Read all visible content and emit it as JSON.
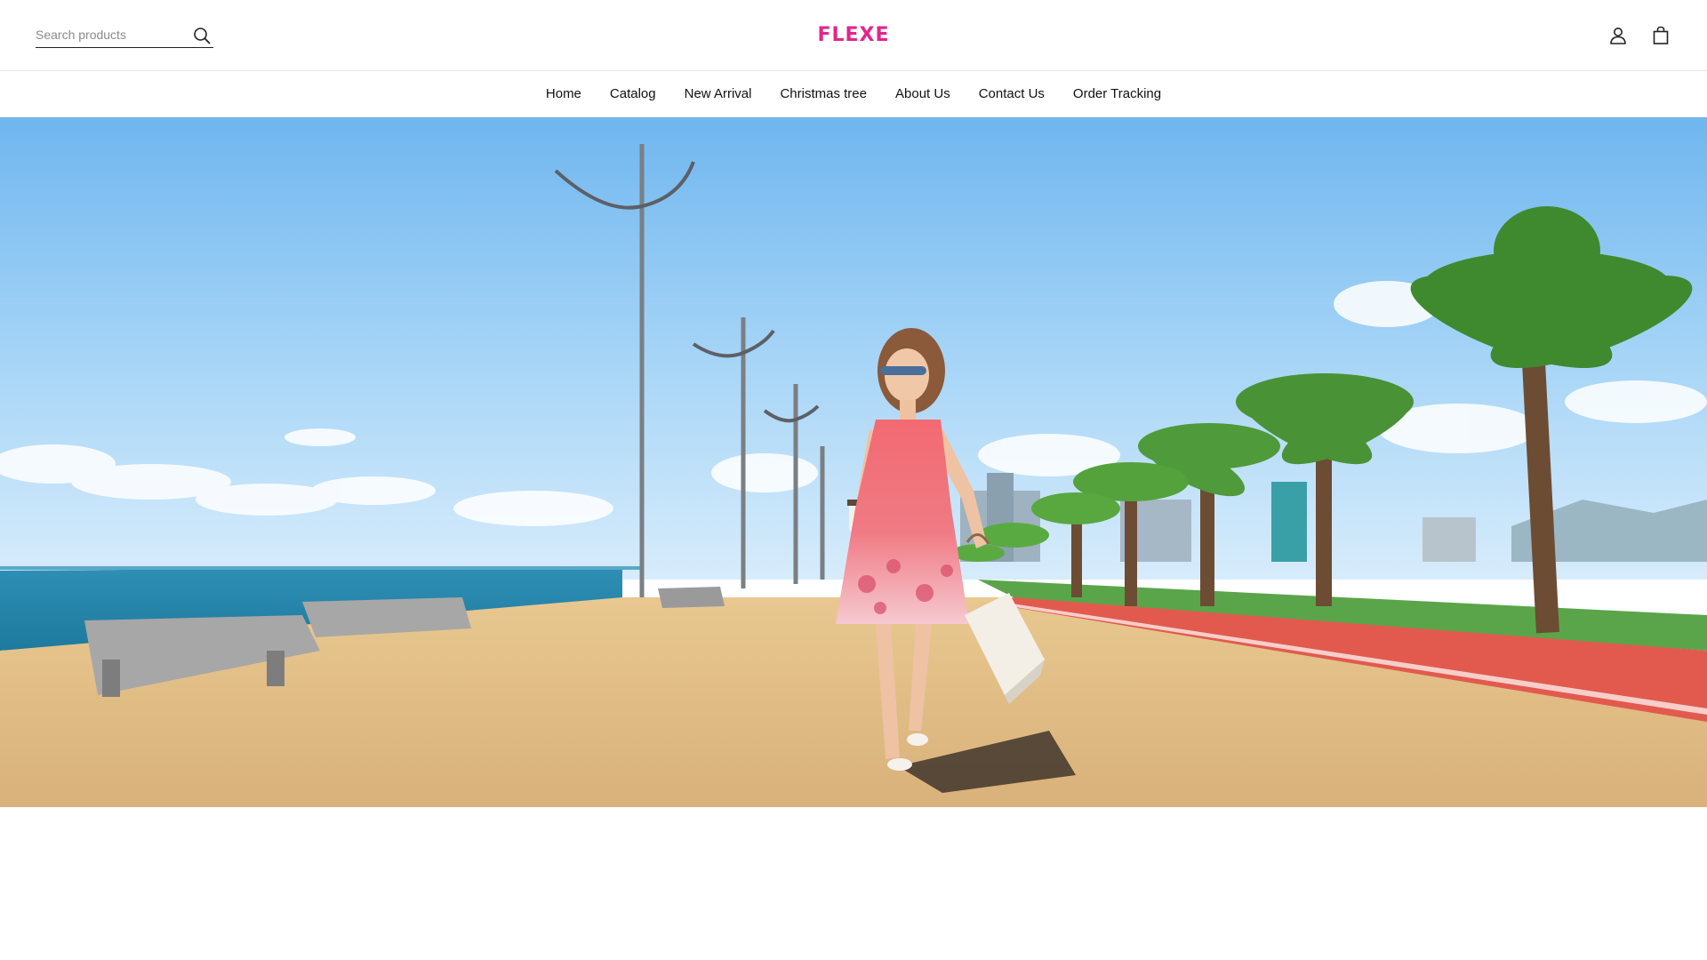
{
  "header": {
    "search": {
      "placeholder": "Search products",
      "icon": "search-icon"
    },
    "logo_text": "FLEXE",
    "icons": [
      "user-icon",
      "shopping-bag-icon"
    ]
  },
  "nav": {
    "items": [
      {
        "label": "Home"
      },
      {
        "label": "Catalog"
      },
      {
        "label": "New Arrival"
      },
      {
        "label": "Christmas tree"
      },
      {
        "label": "About Us"
      },
      {
        "label": "Contact Us"
      },
      {
        "label": "Order Tracking"
      }
    ]
  },
  "hero": {
    "image": "woman-in-pink-dress-walking-on-seaside-promenade"
  },
  "colors": {
    "brand": "#e2268c",
    "text": "#111111",
    "border": "#e6e6e6"
  }
}
